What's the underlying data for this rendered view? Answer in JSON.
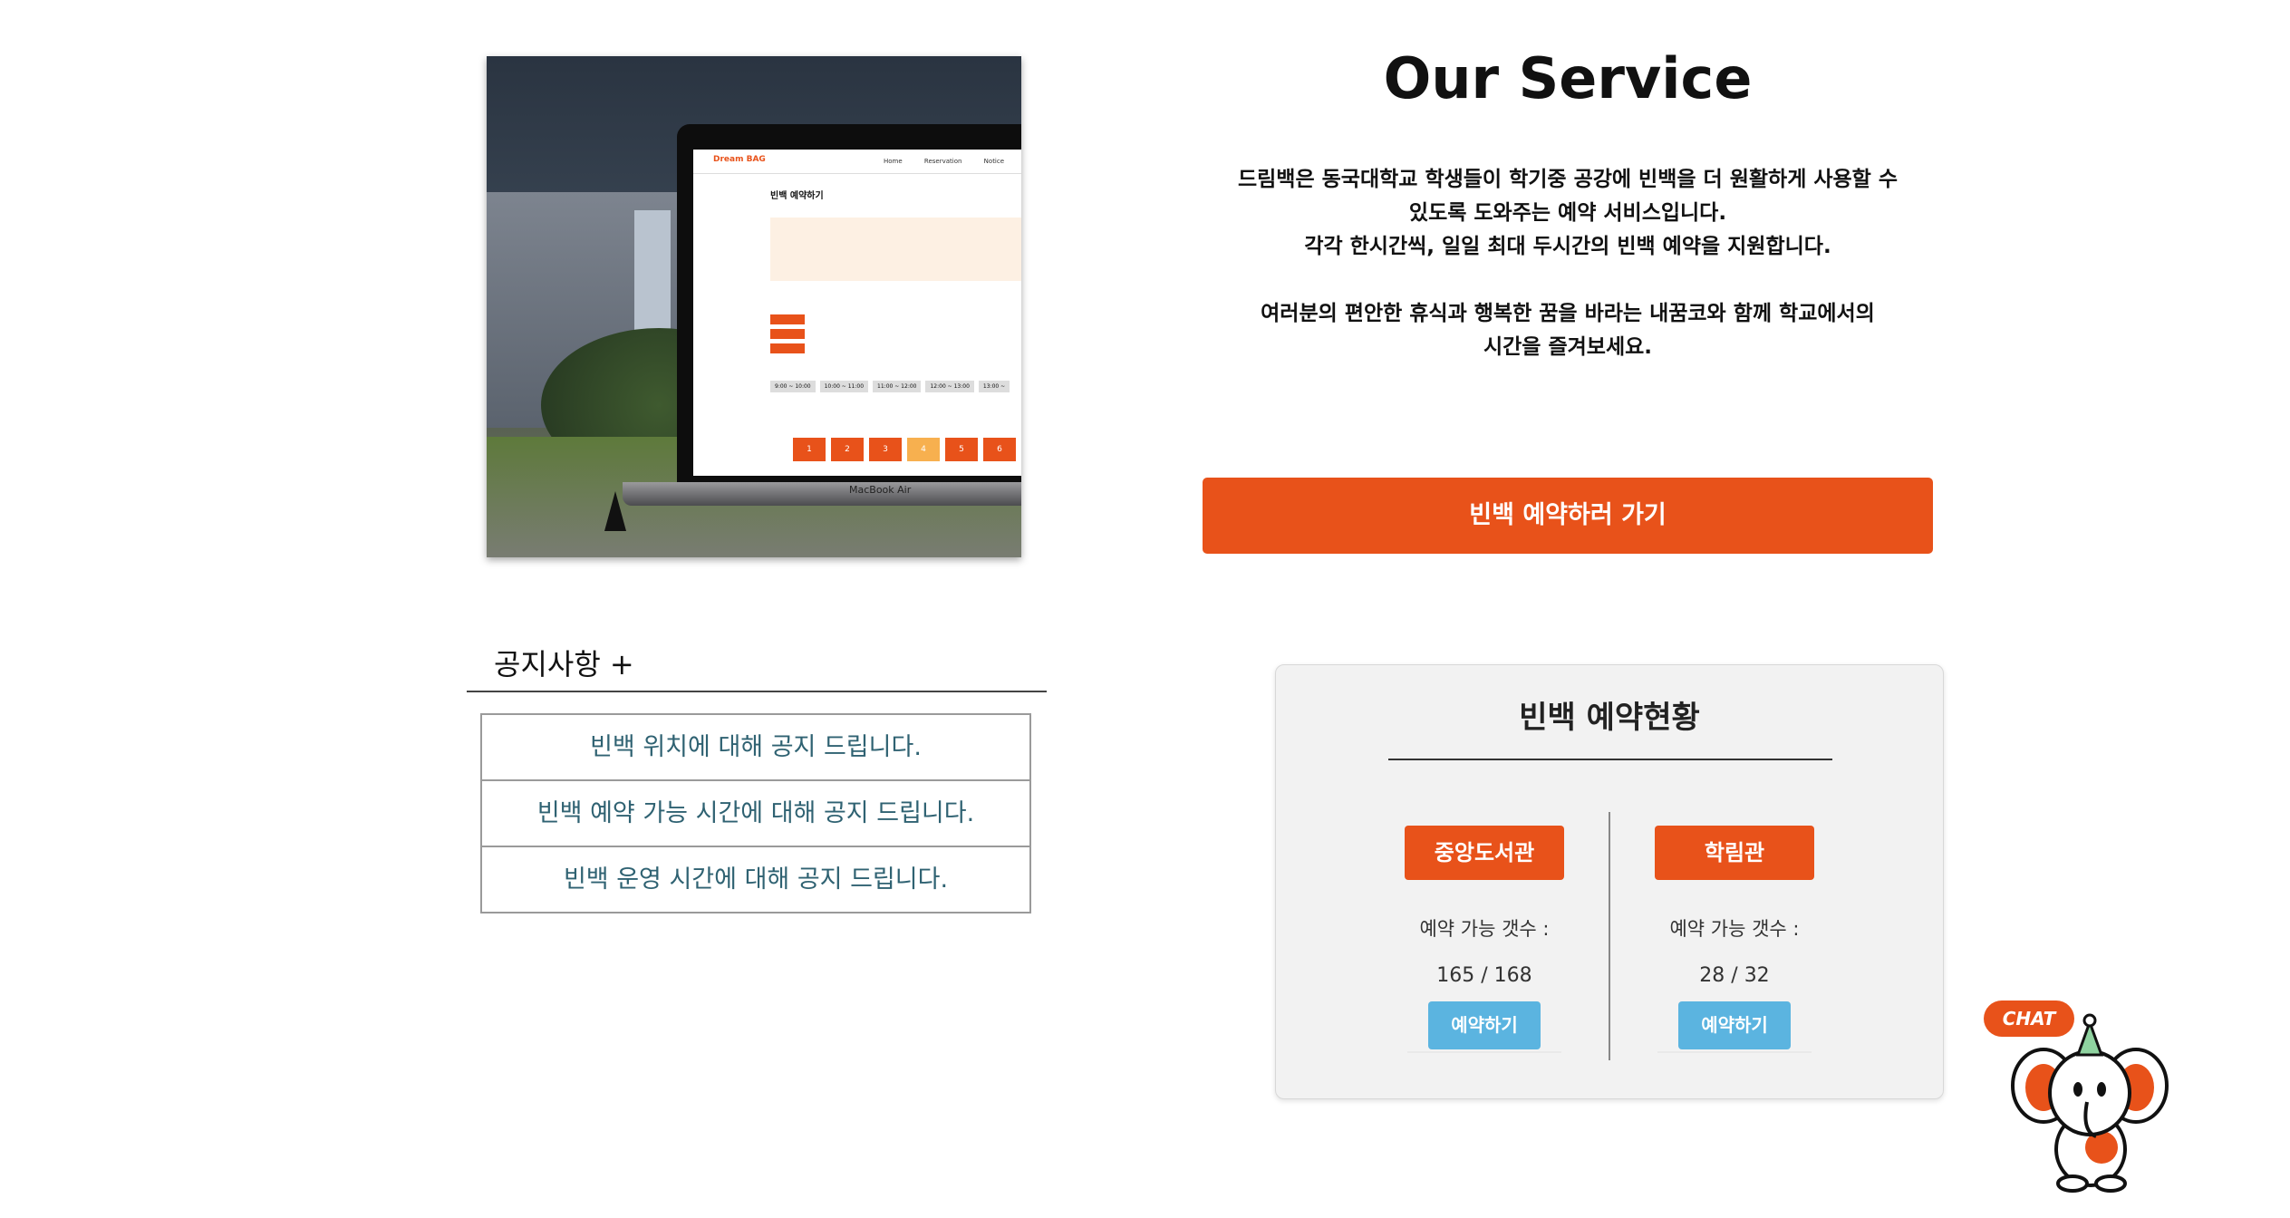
{
  "hero": {
    "screen_logo": "Dream BAG",
    "screen_nav": [
      "Home",
      "Reservation",
      "Notice"
    ],
    "screen_title": "빈백 예약하기",
    "screen_times": [
      "9:00 ~ 10:00",
      "10:00 ~ 11:00",
      "11:00 ~ 12:00",
      "12:00 ~ 13:00",
      "13:00 ~"
    ],
    "screen_seats": [
      "1",
      "2",
      "3",
      "4",
      "5",
      "6"
    ],
    "laptop_brand": "MacBook Air"
  },
  "service": {
    "title": "Our Service",
    "desc_line1": "드림백은 동국대학교 학생들이 학기중 공강에 빈백을 더 원활하게 사용할 수",
    "desc_line2": "있도록 도와주는 예약 서비스입니다.",
    "desc_line3": "각각 한시간씩, 일일 최대 두시간의 빈백 예약을 지원합니다.",
    "desc_line4": "여러분의 편안한 휴식과 행복한 꿈을 바라는 내꿈코와 함께 학교에서의",
    "desc_line5": "시간을 즐겨보세요.",
    "cta_label": "빈백 예약하러 가기"
  },
  "notice": {
    "title": "공지사항 +",
    "items": [
      "빈백 위치에 대해 공지 드립니다.",
      "빈백 예약 가능 시간에 대해 공지 드립니다.",
      "빈백 운영 시간에 대해 공지 드립니다."
    ]
  },
  "status": {
    "title": "빈백 예약현황",
    "facilities": [
      {
        "name": "중앙도서관",
        "avail_label": "예약 가능 갯수 :",
        "count": "165 / 168",
        "button": "예약하기"
      },
      {
        "name": "학림관",
        "avail_label": "예약 가능 갯수 :",
        "count": "28 / 32",
        "button": "예약하기"
      }
    ]
  },
  "chat": {
    "label": "CHAT",
    "colors": {
      "accent": "#e8521a",
      "mascot_ears": "#e8521a",
      "hat": "#8fd3a0"
    }
  },
  "colors": {
    "accent": "#e8521a",
    "reserve_button": "#5bb4e0",
    "notice_text": "#2f6272"
  }
}
